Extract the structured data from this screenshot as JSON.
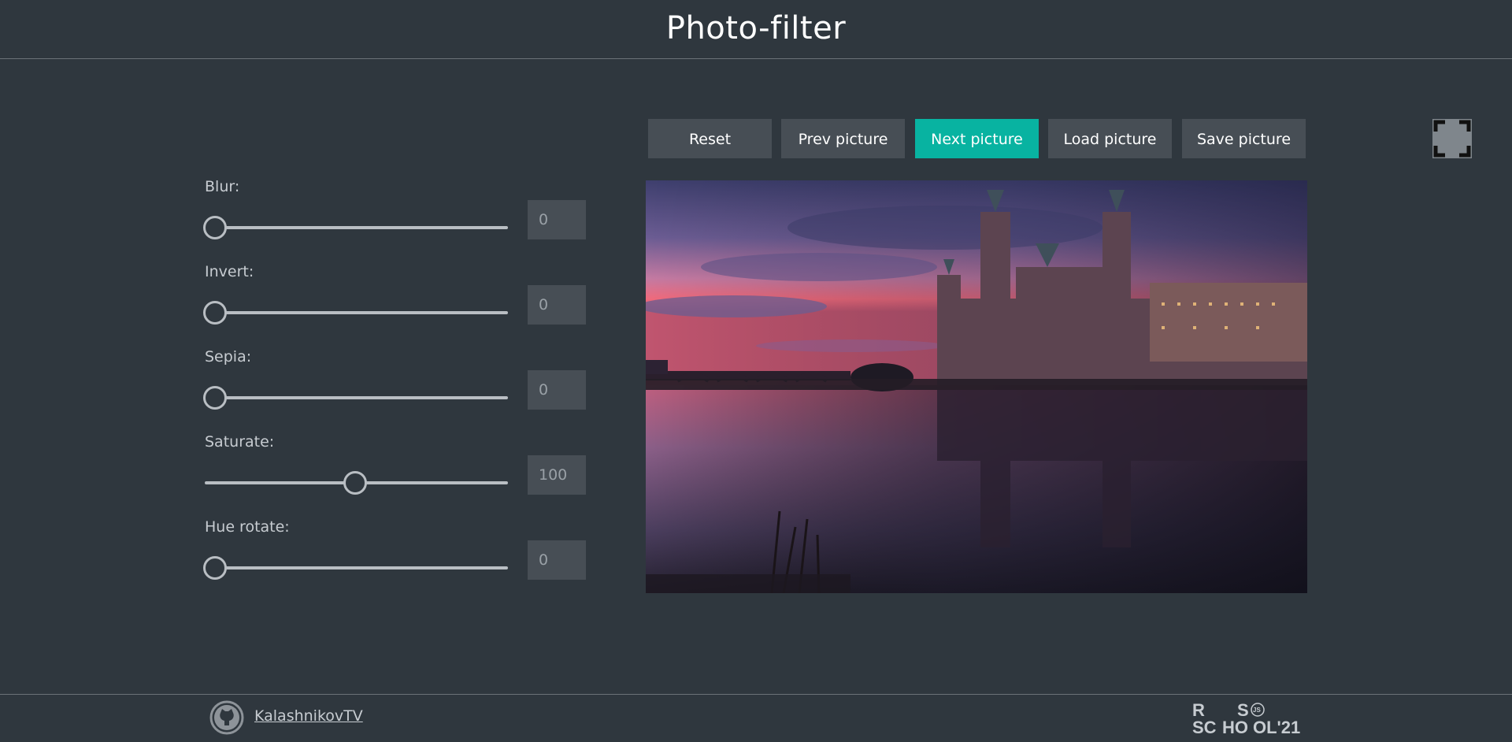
{
  "header": {
    "title": "Photo-filter"
  },
  "filters": [
    {
      "label": "Blur:",
      "value": "0",
      "fraction": 0
    },
    {
      "label": "Invert:",
      "value": "0",
      "fraction": 0
    },
    {
      "label": "Sepia:",
      "value": "0",
      "fraction": 0
    },
    {
      "label": "Saturate:",
      "value": "100",
      "fraction": 0.5
    },
    {
      "label": "Hue rotate:",
      "value": "0",
      "fraction": 0
    }
  ],
  "buttons": [
    {
      "label": "Reset",
      "active": false
    },
    {
      "label": "Prev picture",
      "active": false
    },
    {
      "label": "Next picture",
      "active": true
    },
    {
      "label": "Load picture",
      "active": false
    },
    {
      "label": "Save picture",
      "active": false
    }
  ],
  "colors": {
    "accent": "#08b3a1",
    "background": "#2f373e",
    "button": "#474e55"
  },
  "icons": {
    "fullscreen": "fullscreen-icon",
    "github": "github-icon"
  },
  "footer": {
    "author": "KalashnikovTV",
    "logo_text": {
      "r": "R",
      "s": "S",
      "js": "JS",
      "sc": "SC",
      "ho": "HO",
      "ol": "OL'21"
    }
  }
}
